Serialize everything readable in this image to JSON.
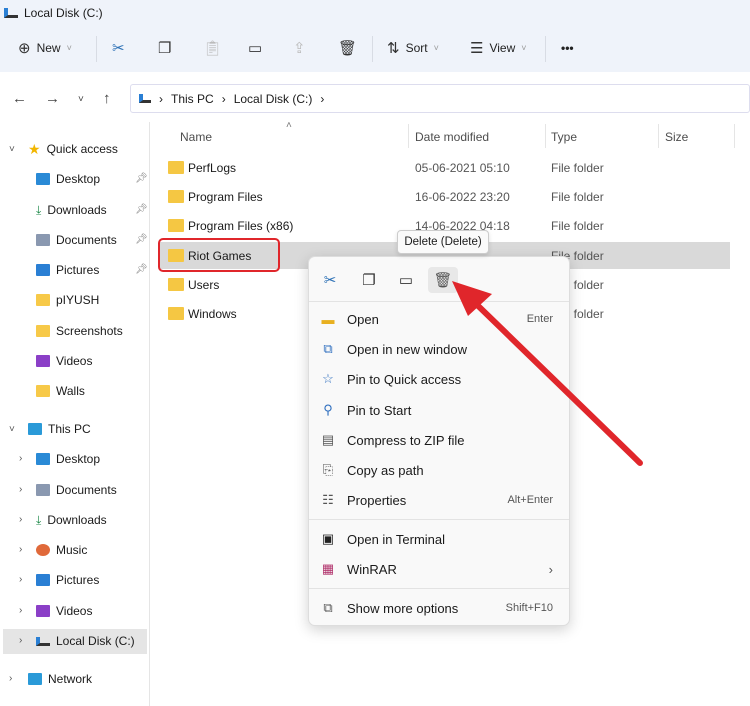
{
  "window": {
    "title": "Local Disk (C:)"
  },
  "toolbar": {
    "new": "New",
    "sort": "Sort",
    "view": "View",
    "more": "•••"
  },
  "address": {
    "crumbs": [
      "This PC",
      "Local Disk (C:)"
    ]
  },
  "sidebar": {
    "quick_access": "Quick access",
    "quick_items": [
      {
        "label": "Desktop",
        "pinned": true
      },
      {
        "label": "Downloads",
        "pinned": true
      },
      {
        "label": "Documents",
        "pinned": true
      },
      {
        "label": "Pictures",
        "pinned": true
      },
      {
        "label": "pIYUSH"
      },
      {
        "label": "Screenshots"
      },
      {
        "label": "Videos"
      },
      {
        "label": "Walls"
      }
    ],
    "this_pc": "This PC",
    "pc_items": [
      "Desktop",
      "Documents",
      "Downloads",
      "Music",
      "Pictures",
      "Videos",
      "Local Disk (C:)"
    ],
    "network": "Network"
  },
  "columns": {
    "name": "Name",
    "date": "Date modified",
    "type": "Type",
    "size": "Size"
  },
  "files": [
    {
      "name": "PerfLogs",
      "date": "05-06-2021 05:10",
      "type": "File folder"
    },
    {
      "name": "Program Files",
      "date": "16-06-2022 23:20",
      "type": "File folder"
    },
    {
      "name": "Program Files (x86)",
      "date": "14-06-2022 04:18",
      "type": "File folder"
    },
    {
      "name": "Riot Games",
      "date": "",
      "type": "File folder",
      "selected": true
    },
    {
      "name": "Users",
      "date": "",
      "type": "File folder"
    },
    {
      "name": "Windows",
      "date": "",
      "type": "File folder"
    }
  ],
  "tooltip": "Delete (Delete)",
  "context_menu": {
    "items": [
      {
        "label": "Open",
        "shortcut": "Enter"
      },
      {
        "label": "Open in new window"
      },
      {
        "label": "Pin to Quick access"
      },
      {
        "label": "Pin to Start"
      },
      {
        "label": "Compress to ZIP file"
      },
      {
        "label": "Copy as path"
      },
      {
        "label": "Properties",
        "shortcut": "Alt+Enter"
      },
      {
        "label": "Open in Terminal"
      },
      {
        "label": "WinRAR",
        "submenu": true
      },
      {
        "label": "Show more options",
        "shortcut": "Shift+F10"
      }
    ]
  },
  "colors": {
    "highlight": "#e0262b",
    "selected_row": "#d9d9d9",
    "accent": "#2f6fbf"
  }
}
